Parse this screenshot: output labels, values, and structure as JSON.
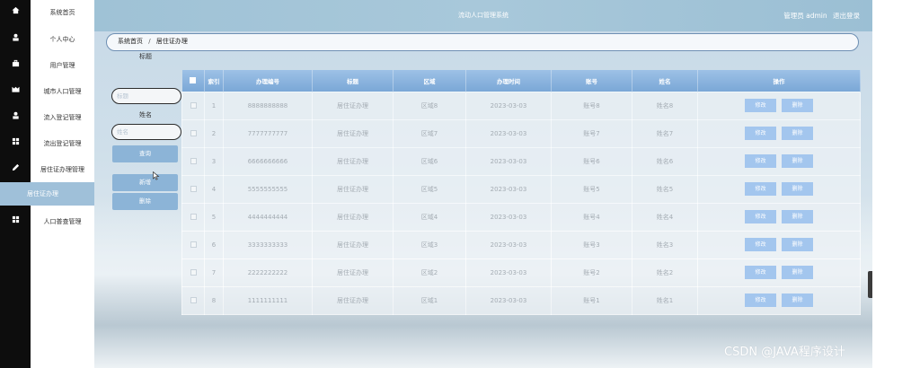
{
  "sidebar": {
    "items": [
      {
        "label": "系统首页",
        "icon": "home-icon"
      },
      {
        "label": "个人中心",
        "icon": "user-icon"
      },
      {
        "label": "用户管理",
        "icon": "briefcase-icon"
      },
      {
        "label": "城市人口管理",
        "icon": "city-icon"
      },
      {
        "label": "流入登记管理",
        "icon": "user-icon"
      },
      {
        "label": "流出登记管理",
        "icon": "grid-icon"
      },
      {
        "label": "居住证办理管理",
        "icon": "pencil-icon"
      }
    ],
    "active_sub": {
      "label": "居住证办理"
    },
    "last_item": {
      "label": "人口普查管理",
      "icon": "grid-icon"
    }
  },
  "header": {
    "title": "流动人口管理系统",
    "user_text": "管理员 admin",
    "logout_label": "退出登录"
  },
  "breadcrumb": {
    "home": "系统首页",
    "separator": "/",
    "current": "居住证办理"
  },
  "search": {
    "title_label": "标题",
    "title_placeholder": "标题",
    "name_label": "姓名",
    "name_placeholder": "姓名",
    "query_button": "查询",
    "add_button": "新增",
    "delete_button": "删除"
  },
  "table": {
    "columns": [
      "索引",
      "办理编号",
      "标题",
      "区域",
      "办理时间",
      "账号",
      "姓名",
      "操作"
    ],
    "edit_label": "修改",
    "delete_label": "删除",
    "rows": [
      {
        "index": "1",
        "number": "8888888888",
        "title": "居住证办理",
        "region": "区域8",
        "date": "2023-03-03",
        "account": "账号8",
        "name": "姓名8"
      },
      {
        "index": "2",
        "number": "7777777777",
        "title": "居住证办理",
        "region": "区域7",
        "date": "2023-03-03",
        "account": "账号7",
        "name": "姓名7"
      },
      {
        "index": "3",
        "number": "6666666666",
        "title": "居住证办理",
        "region": "区域6",
        "date": "2023-03-03",
        "account": "账号6",
        "name": "姓名6"
      },
      {
        "index": "4",
        "number": "5555555555",
        "title": "居住证办理",
        "region": "区域5",
        "date": "2023-03-03",
        "account": "账号5",
        "name": "姓名5"
      },
      {
        "index": "5",
        "number": "4444444444",
        "title": "居住证办理",
        "region": "区域4",
        "date": "2023-03-03",
        "account": "账号4",
        "name": "姓名4"
      },
      {
        "index": "6",
        "number": "3333333333",
        "title": "居住证办理",
        "region": "区域3",
        "date": "2023-03-03",
        "account": "账号3",
        "name": "姓名3"
      },
      {
        "index": "7",
        "number": "2222222222",
        "title": "居住证办理",
        "region": "区域2",
        "date": "2023-03-03",
        "account": "账号2",
        "name": "姓名2"
      },
      {
        "index": "8",
        "number": "1111111111",
        "title": "居住证办理",
        "region": "区域1",
        "date": "2023-03-03",
        "account": "账号1",
        "name": "姓名1"
      }
    ]
  },
  "watermark": "CSDN @JAVA程序设计",
  "colors": {
    "rail": "#0d0d0d",
    "header": "#9fc2d6",
    "table_header": "#7aa7d6",
    "button": "#8cb4d7",
    "action_button": "#a3c6ee",
    "active_menu": "#9fc0d9"
  }
}
